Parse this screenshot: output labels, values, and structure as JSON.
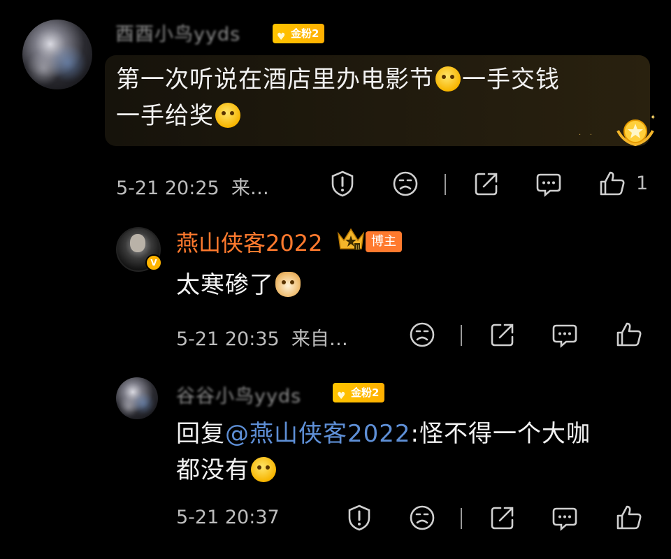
{
  "comments": [
    {
      "author": "酉酉小鸟yyds",
      "fan_badge": "金粉2",
      "text_line1": "第一次听说在酒店里办电影节",
      "text_line1_b": "一手交钱",
      "text_line2": "一手给奖",
      "time": "5-21 20:25",
      "source": "来…",
      "like_count": "1"
    },
    {
      "author": "燕山侠客2022",
      "badge": "博主",
      "text": "太寒碜了",
      "time": "5-21 20:35",
      "source": "来自…"
    },
    {
      "author": "谷谷小鸟yyds",
      "fan_badge": "金粉2",
      "reply_prefix": "回复",
      "mention": "@燕山侠客2022",
      "text_line1": ":怪不得一个大咖",
      "text_line2": "都没有",
      "time": "5-21 20:37"
    }
  ],
  "colors": {
    "background": "#000000",
    "blogger_name": "#ff7a2e",
    "mention": "#5e8fd6",
    "fan_badge": "#ffb000"
  },
  "icons": [
    "report-icon",
    "dislike-face-icon",
    "share-icon",
    "comment-icon",
    "like-thumb-icon"
  ]
}
